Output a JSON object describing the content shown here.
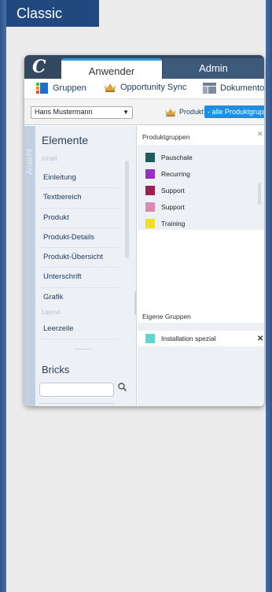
{
  "badge": "Classic",
  "tabs": {
    "anwender": "Anwender",
    "admin": "Admin"
  },
  "toolbar": {
    "gruppen": "Gruppen",
    "opportunity_sync": "Opportunity Sync",
    "dokumentoptionen": "Dokumentoptic"
  },
  "filter": {
    "user": "Hans Mustermann",
    "produkt_label": "Produkt:",
    "produkt_value": "- alle Produktgrupp"
  },
  "sidebar": {
    "vertical_label": "Ansicht",
    "title": "Elemente",
    "section_inhalt": "Inhalt",
    "items": [
      "Einleitung",
      "Textbereich",
      "Produkt",
      "Produkt-Details",
      "Produkt-Übersicht",
      "Unterschrift",
      "Grafik"
    ],
    "section_layout": "Layout",
    "layout_items": [
      "Leerzeile"
    ],
    "bricks_title": "Bricks"
  },
  "produktgruppen": {
    "title": "Produktgruppen",
    "items": [
      {
        "label": "Pauschale",
        "color": "#1f5a5c"
      },
      {
        "label": "Recurring",
        "color": "#9b2ec2"
      },
      {
        "label": "Support",
        "color": "#9c1f4f"
      },
      {
        "label": "Support",
        "color": "#d98bb3"
      },
      {
        "label": "Training",
        "color": "#f2e21d"
      }
    ]
  },
  "eigene_gruppen": {
    "title": "Eigene Gruppen",
    "items": [
      {
        "label": "Installation spezial",
        "color": "#5fd6d2"
      }
    ]
  },
  "colors": {
    "accent": "#1e8fe0",
    "header": "#33475e",
    "dot": "#3a5a84",
    "dot_alert": "#e35866"
  }
}
